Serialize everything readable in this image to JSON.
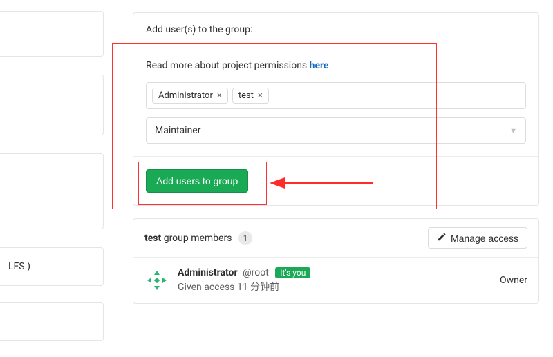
{
  "sidebar": {
    "lfs_label": "LFS )"
  },
  "add_panel": {
    "title": "Add user(s) to the group:",
    "permissions_prefix": "Read more about project permissions ",
    "permissions_link": "here",
    "chips": [
      {
        "label": "Administrator"
      },
      {
        "label": "test"
      }
    ],
    "role_selected": "Maintainer",
    "submit_label": "Add users to group"
  },
  "members_panel": {
    "title_bold": "test",
    "title_rest": " group members",
    "count": "1",
    "manage_label": "Manage access",
    "member": {
      "name": "Administrator",
      "handle": "@root",
      "you_badge": "It's you",
      "sub_prefix": "Given access ",
      "sub_time": "11 分钟前",
      "role": "Owner"
    }
  }
}
